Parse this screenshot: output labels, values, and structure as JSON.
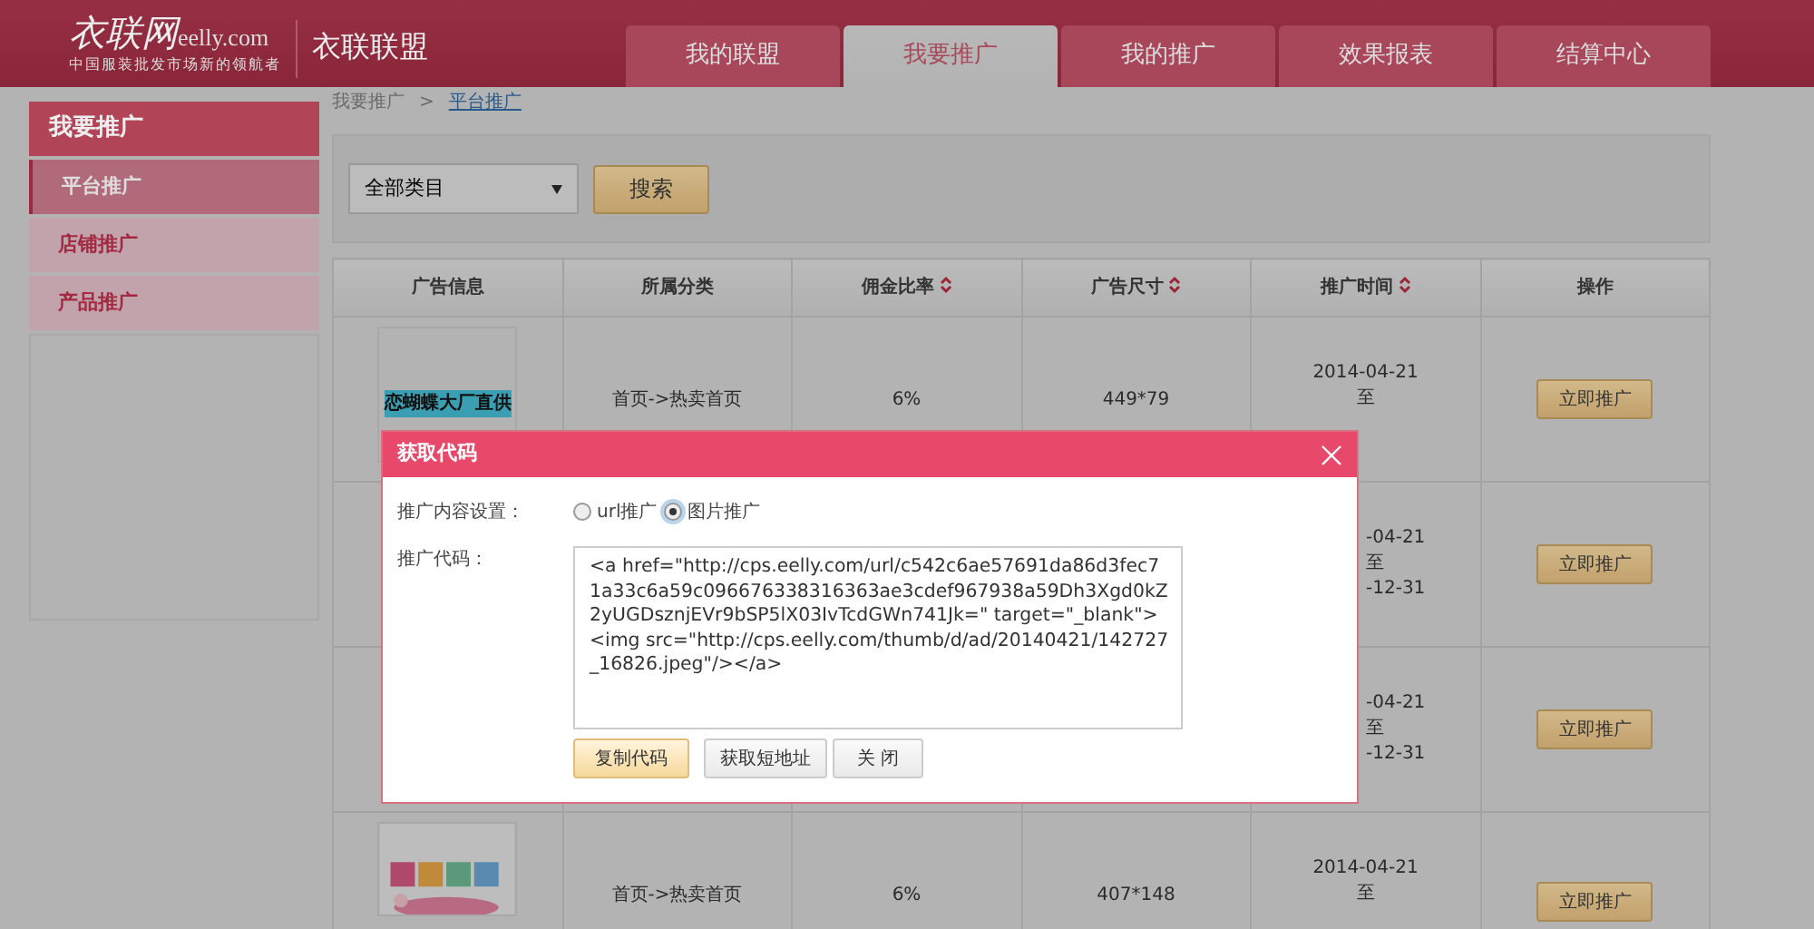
{
  "header": {
    "logo": {
      "mark": "衣联网",
      "domain": "eelly.com",
      "tagline": "中国服装批发市场新的领航者"
    },
    "site_title": "衣联联盟"
  },
  "nav_tabs": [
    {
      "label": "我的联盟",
      "selected": false
    },
    {
      "label": "我要推广",
      "selected": true
    },
    {
      "label": "我的推广",
      "selected": false
    },
    {
      "label": "效果报表",
      "selected": false
    },
    {
      "label": "结算中心",
      "selected": false
    }
  ],
  "sidebar": {
    "title": "我要推广",
    "items": [
      {
        "label": "平台推广",
        "selected": true
      },
      {
        "label": "店铺推广",
        "selected": false
      },
      {
        "label": "产品推广",
        "selected": false
      }
    ]
  },
  "breadcrumb": {
    "items": [
      "我要推广",
      "平台推广"
    ],
    "separator": ">"
  },
  "filter": {
    "category": "全部类目",
    "search_button": "搜索"
  },
  "table": {
    "columns": [
      {
        "label": "广告信息",
        "sortable": false
      },
      {
        "label": "所属分类",
        "sortable": false
      },
      {
        "label": "佣金比率",
        "sortable": true
      },
      {
        "label": "广告尺寸",
        "sortable": true
      },
      {
        "label": "推广时间",
        "sortable": true
      },
      {
        "label": "操作",
        "sortable": false
      }
    ],
    "rows": [
      {
        "ad": {
          "kind": "text",
          "text": "恋蝴蝶大厂直供"
        },
        "category": "首页->热卖首页",
        "commission": "6%",
        "size": "449*79",
        "dates": [
          "2014-04-21",
          "至"
        ],
        "dates_clipped": false,
        "action": "立即推广"
      },
      {
        "dates": [
          "-04-21",
          "至",
          "-12-31"
        ],
        "dates_clipped": true,
        "action": "立即推广"
      },
      {
        "dates": [
          "-04-21",
          "至",
          "-12-31"
        ],
        "dates_clipped": true,
        "action": "立即推广"
      },
      {
        "ad": {
          "kind": "picture"
        },
        "category": "首页->热卖首页",
        "commission": "6%",
        "size": "407*148",
        "dates": [
          "2014-04-21",
          "至"
        ],
        "dates_clipped": false,
        "action": "立即推广"
      }
    ]
  },
  "dialog": {
    "title": "获取代码",
    "content_label": "推广内容设置：",
    "options": [
      {
        "label": "url推广",
        "selected": false
      },
      {
        "label": "图片推广",
        "selected": true
      }
    ],
    "code_label": "推广代码：",
    "code": "<a href=\"http://cps.eelly.com/url/c542c6ae57691da86d3fec71a33c6a59c096676338316363ae3cdef967938a59Dh3Xgd0kZ2yUGDsznjEVr9bSP5lX03IvTcdGWn741Jk=\" target=\"_blank\"><img src=\"http://cps.eelly.com/thumb/d/ad/20140421/142727_16826.jpeg\"/></a>",
    "buttons": [
      {
        "label": "复制代码",
        "kind": "primary"
      },
      {
        "label": "获取短地址",
        "kind": "default"
      },
      {
        "label": "关 闭",
        "kind": "default"
      }
    ]
  }
}
